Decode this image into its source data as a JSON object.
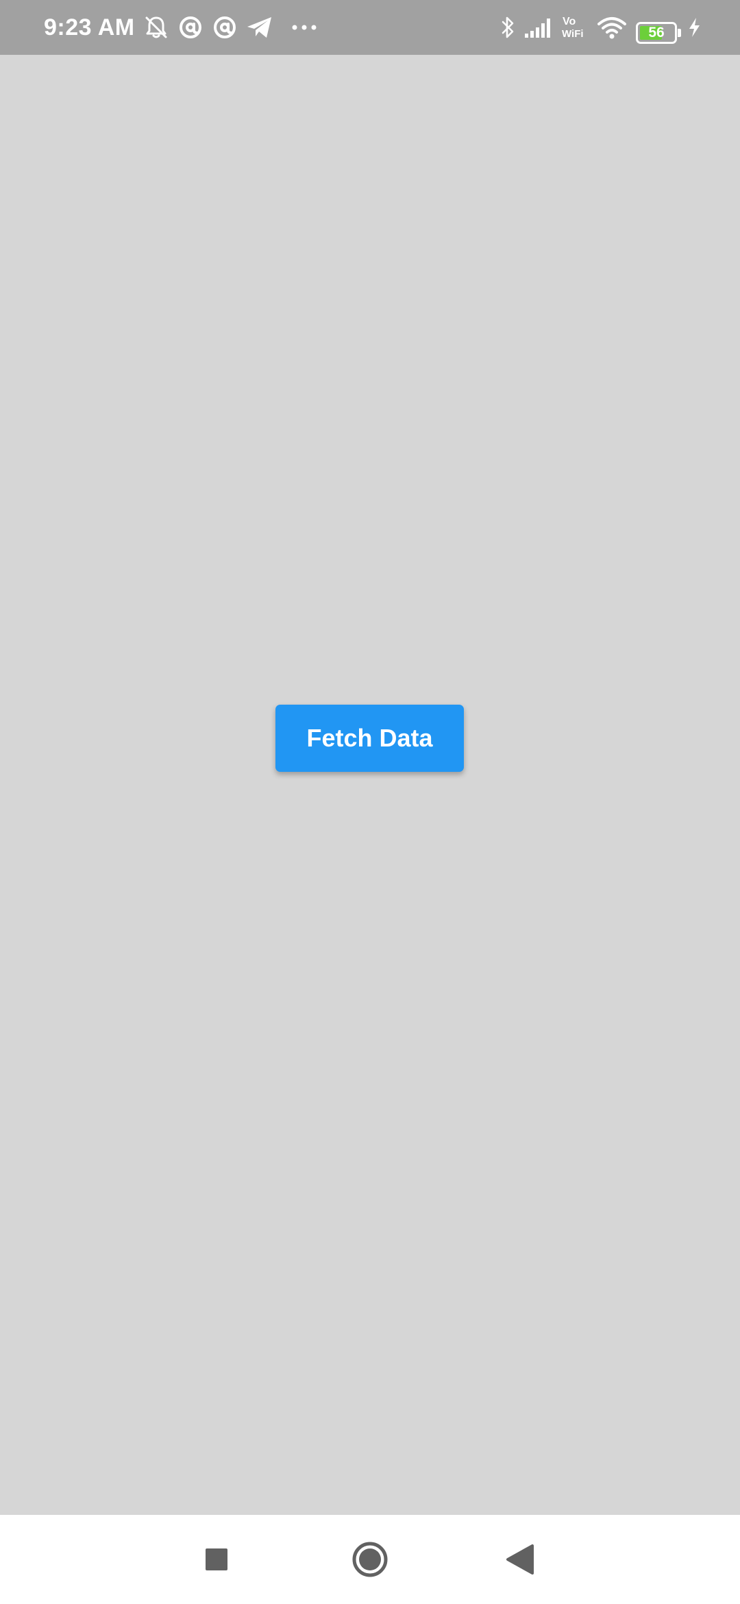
{
  "status_bar": {
    "time": "9:23 AM",
    "battery_level": "56",
    "colors": {
      "background": "#a1a1a1",
      "icons": "#ffffff",
      "battery_fill": "#6ccf3a"
    },
    "left_icons": [
      "notifications-muted-icon",
      "at-sign-icon",
      "at-sign-icon",
      "telegram-icon",
      "more-dots-icon"
    ],
    "right_icons": [
      "bluetooth-icon",
      "signal-icon",
      "vowifi-icon",
      "wifi-icon",
      "battery-icon",
      "charging-icon"
    ],
    "vowifi_label_top": "Vo",
    "vowifi_label_bottom": "WiFi"
  },
  "main": {
    "background": "#d6d6d6",
    "fetch_button_label": "Fetch Data",
    "button_color": "#2196f3"
  },
  "nav_bar": {
    "buttons": [
      "recent-apps-button",
      "home-button",
      "back-button"
    ],
    "icon_color": "#616161"
  }
}
